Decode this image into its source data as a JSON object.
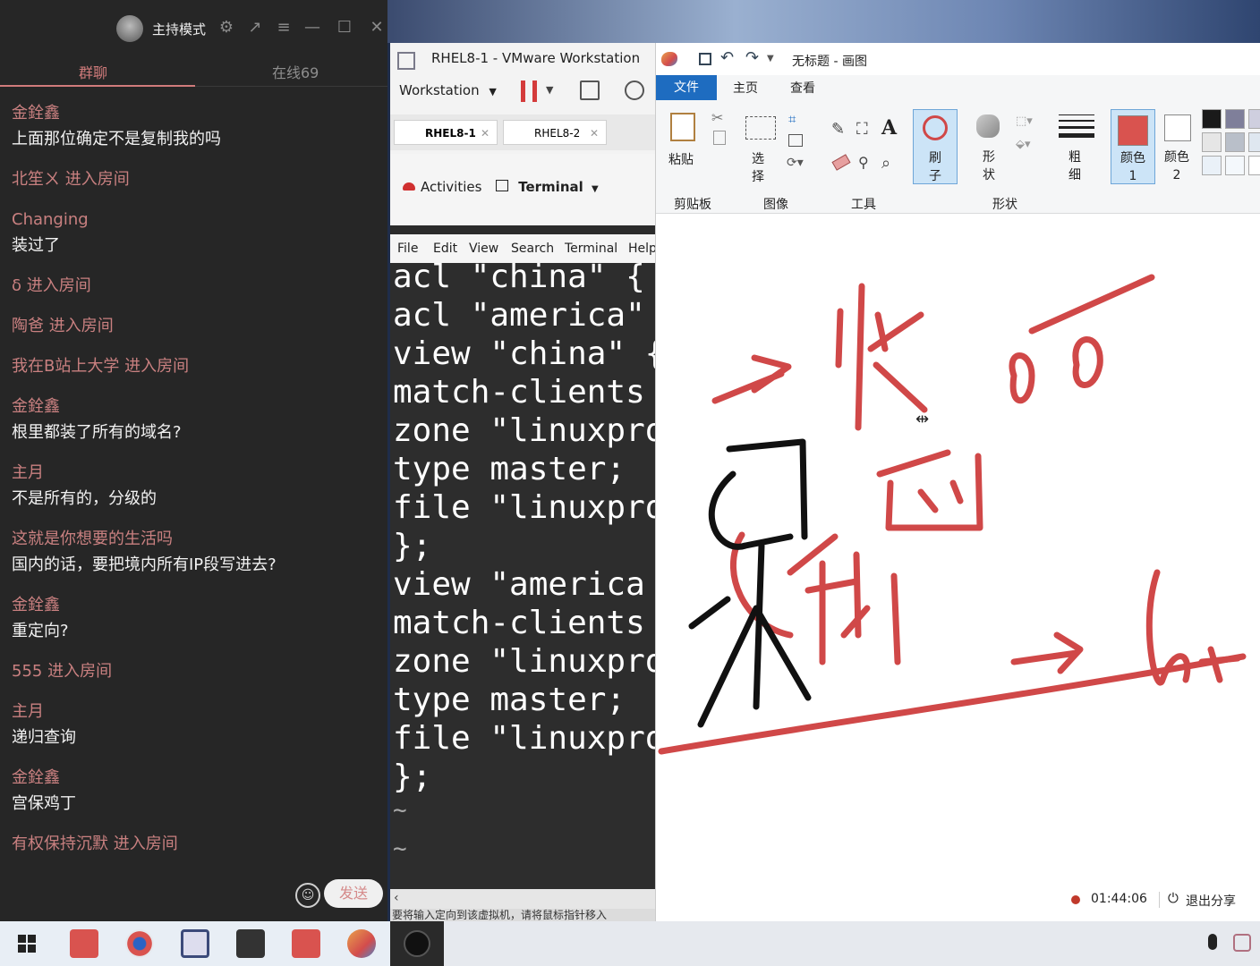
{
  "chat": {
    "mode_label": "主持模式",
    "tabs": [
      "群聊",
      "在线69"
    ],
    "messages": [
      {
        "type": "msg",
        "nick": "金銓鑫",
        "text": "上面那位确定不是复制我的吗"
      },
      {
        "type": "join",
        "text": "北笙ㄨ 进入房间"
      },
      {
        "type": "msg",
        "nick": "Changing",
        "text": "装过了"
      },
      {
        "type": "join",
        "text": "δ 进入房间"
      },
      {
        "type": "join",
        "text": "陶爸 进入房间"
      },
      {
        "type": "join",
        "text": "我在B站上大学 进入房间"
      },
      {
        "type": "msg",
        "nick": "金銓鑫",
        "text": "根里都装了所有的域名?"
      },
      {
        "type": "msg",
        "nick": "主月",
        "text": "不是所有的，分级的"
      },
      {
        "type": "msg",
        "nick": "这就是你想要的生活吗",
        "text": "国内的话，要把境内所有IP段写进去?"
      },
      {
        "type": "msg",
        "nick": "金銓鑫",
        "text": "重定向?"
      },
      {
        "type": "join",
        "text": "555 进入房间"
      },
      {
        "type": "msg",
        "nick": "主月",
        "text": "递归查询"
      },
      {
        "type": "msg",
        "nick": "金銓鑫",
        "text": "宫保鸡丁"
      },
      {
        "type": "join",
        "text": "有权保持沉默 进入房间"
      }
    ],
    "send_label": "发送"
  },
  "vmware": {
    "title": "RHEL8-1 - VMware Workstation",
    "menu_label": "Workstation",
    "tabs": [
      "RHEL8-1",
      "RHEL8-2"
    ],
    "gnome": {
      "activities": "Activities",
      "app": "Terminal"
    },
    "terminal_menu": [
      "File",
      "Edit",
      "View",
      "Search",
      "Terminal",
      "Help"
    ],
    "terminal_lines": [
      "acl \"china\" {",
      "acl \"america\"",
      "view \"china\" {",
      "match-clients",
      "zone \"linuxpro",
      "type master;",
      "file \"linuxpro",
      "};",
      "view \"america",
      "match-clients",
      "zone \"linuxpro",
      "type master;",
      "file \"linuxpro",
      "};",
      "~",
      "~"
    ],
    "status": "要将输入定向到该虚拟机，请将鼠标指针移入"
  },
  "paint": {
    "title": "无标题 - 画图",
    "tabs": [
      "文件",
      "主页",
      "查看"
    ],
    "tools": {
      "paste": "粘贴",
      "select": "选择",
      "brush": "刷子",
      "shapes": "形状",
      "thickness": "粗细",
      "color1": "颜色 1",
      "color2": "颜色 2"
    },
    "groups": [
      "剪贴板",
      "图像",
      "工具",
      "形状"
    ],
    "palette": [
      "#1a1a1a",
      "#7f7f9a",
      "#cfcfdf",
      "#e6e6e6",
      "#b9bfc9",
      "#dfe7f0",
      "#eaf1f8",
      "#f4f8fc",
      "#ffffff"
    ],
    "color1": "#d9534f",
    "color2": "#ffffff",
    "timer": "01:44:06",
    "exit_share": "退出分享"
  },
  "colors": {
    "ink_red": "#d04848",
    "ink_black": "#111111",
    "chat_bg": "#262626",
    "accent": "#c98080"
  }
}
